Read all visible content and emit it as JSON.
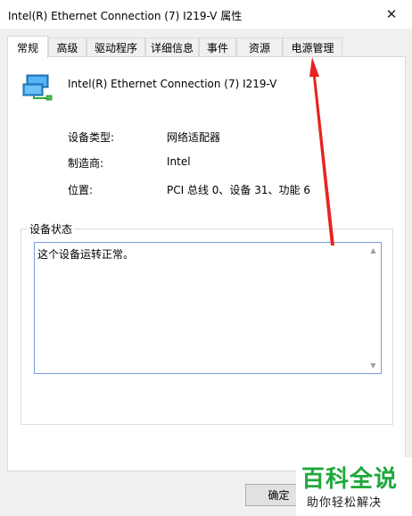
{
  "window": {
    "title": "Intel(R) Ethernet Connection (7) I219-V 属性",
    "close_glyph": "✕"
  },
  "tabs": [
    {
      "label": "常规",
      "active": true
    },
    {
      "label": "高级",
      "active": false
    },
    {
      "label": "驱动程序",
      "active": false
    },
    {
      "label": "详细信息",
      "active": false
    },
    {
      "label": "事件",
      "active": false
    },
    {
      "label": "资源",
      "active": false
    },
    {
      "label": "电源管理",
      "active": false
    }
  ],
  "device": {
    "icon": "network-adapter-icon",
    "name": "Intel(R) Ethernet Connection (7) I219-V"
  },
  "properties": [
    {
      "label": "设备类型:",
      "value": "网络适配器"
    },
    {
      "label": "制造商:",
      "value": "Intel"
    },
    {
      "label": "位置:",
      "value": "PCI 总线 0、设备 31、功能 6"
    }
  ],
  "status": {
    "group_title": "设备状态",
    "text": "这个设备运转正常。"
  },
  "buttons": {
    "ok": "确定"
  },
  "watermark": {
    "main": "百科全说",
    "sub": "助你轻松解决"
  },
  "annotation": {
    "arrow_color": "#e8231f"
  }
}
